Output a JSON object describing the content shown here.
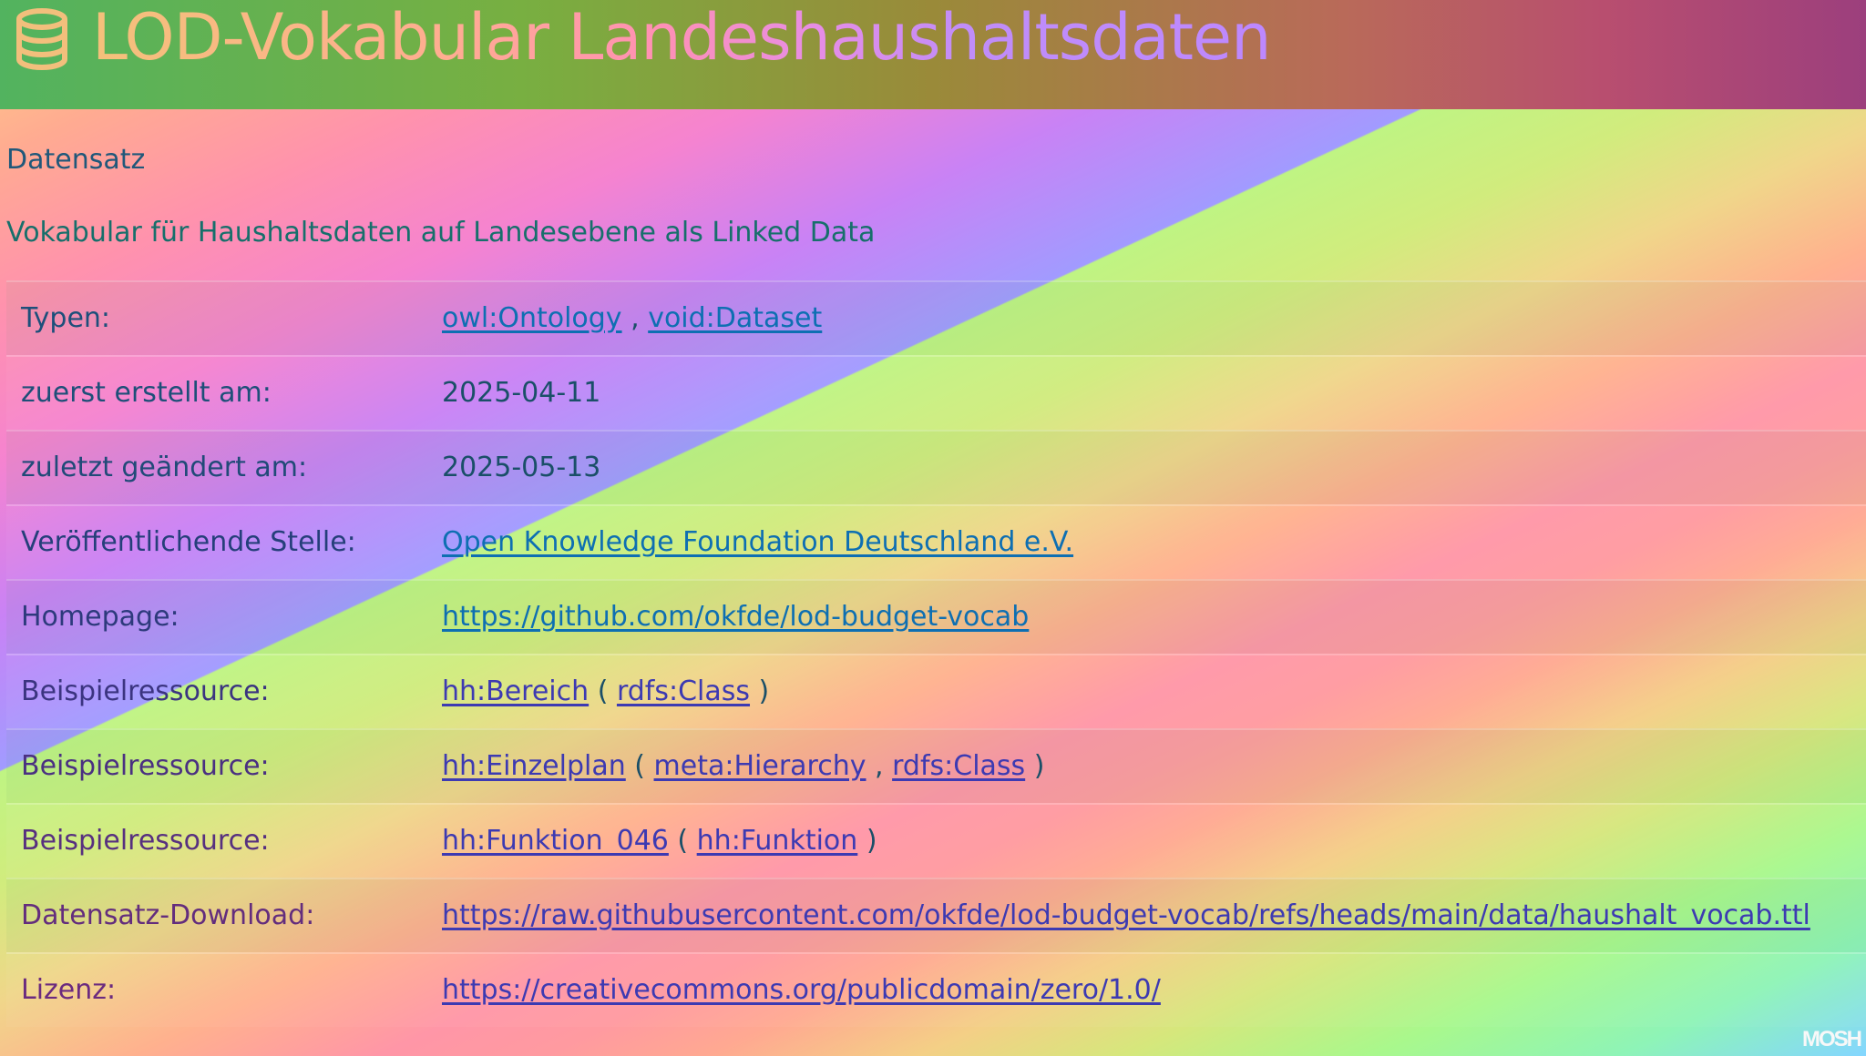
{
  "header": {
    "icon": "database-icon",
    "title": "LOD-Vokabular Landeshaushaltsdaten"
  },
  "dataset": {
    "kind": "Datensatz",
    "description": "Vokabular für Haushaltsdaten auf Landesebene als Linked Data"
  },
  "rows": [
    {
      "label": "Typen:",
      "values": [
        {
          "text": "owl:Ontology",
          "link": true
        },
        {
          "text": " , ",
          "link": false
        },
        {
          "text": "void:Dataset",
          "link": true
        }
      ]
    },
    {
      "label": "zuerst erstellt am:",
      "values": [
        {
          "text": "2025-04-11",
          "link": false
        }
      ]
    },
    {
      "label": "zuletzt geändert am:",
      "values": [
        {
          "text": "2025-05-13",
          "link": false
        }
      ]
    },
    {
      "label": "Veröffentlichende Stelle:",
      "values": [
        {
          "text": "Open Knowledge Foundation Deutschland e.V.",
          "link": true
        }
      ]
    },
    {
      "label": "Homepage:",
      "values": [
        {
          "text": "https://github.com/okfde/lod-budget-vocab",
          "link": true
        }
      ]
    },
    {
      "label": "Beispielressource:",
      "values": [
        {
          "text": "hh:Bereich",
          "link": true
        },
        {
          "text": " ( ",
          "link": false
        },
        {
          "text": "rdfs:Class",
          "link": true
        },
        {
          "text": " )",
          "link": false
        }
      ]
    },
    {
      "label": "Beispielressource:",
      "values": [
        {
          "text": "hh:Einzelplan",
          "link": true
        },
        {
          "text": " ( ",
          "link": false
        },
        {
          "text": "meta:Hierarchy",
          "link": true
        },
        {
          "text": " , ",
          "link": false
        },
        {
          "text": "rdfs:Class",
          "link": true
        },
        {
          "text": " )",
          "link": false
        }
      ]
    },
    {
      "label": "Beispielressource:",
      "values": [
        {
          "text": "hh:Funktion_046",
          "link": true
        },
        {
          "text": " ( ",
          "link": false
        },
        {
          "text": "hh:Funktion",
          "link": true
        },
        {
          "text": " )",
          "link": false
        }
      ]
    },
    {
      "label": "Datensatz-Download:",
      "values": [
        {
          "text": "https://raw.githubusercontent.com/okfde/lod-budget-vocab/refs/heads/main/data/haushalt_vocab.ttl",
          "link": true
        }
      ]
    },
    {
      "label": "Lizenz:",
      "values": [
        {
          "text": "https://creativecommons.org/publicdomain/zero/1.0/",
          "link": true
        }
      ]
    }
  ],
  "watermark": "MOSH",
  "colors": {
    "header_start": "#52b35f",
    "header_end": "#9c3f7d",
    "link": "#0e6fb2",
    "label_top": "#1d4f7a",
    "label_bottom": "#6b2a7f"
  }
}
